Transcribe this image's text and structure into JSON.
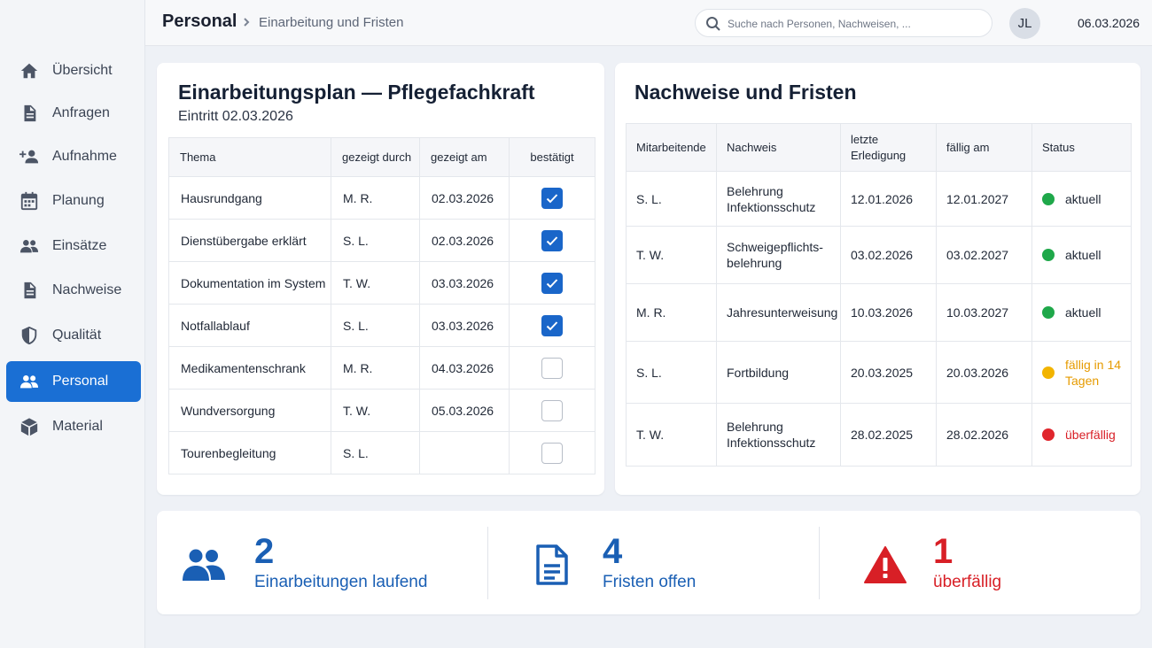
{
  "colors": {
    "accent": "#1a6fd4",
    "checkbox_on": "#1a66c9",
    "status_current": "#1fa84a",
    "status_due_soon": "#f2b400",
    "status_overdue": "#e0262d",
    "text_due_soon": "#e69b00",
    "text_overdue": "#d81f26",
    "stat_blue": "#1a5fb4",
    "stat_red": "#d81f26"
  },
  "sidebar": {
    "items": [
      {
        "label": "Übersicht",
        "icon": "home-icon",
        "active": false
      },
      {
        "label": "Anfragen",
        "icon": "document-icon",
        "active": false
      },
      {
        "label": "Aufnahme",
        "icon": "person-add-icon",
        "active": false
      },
      {
        "label": "Planung",
        "icon": "calendar-icon",
        "active": false
      },
      {
        "label": "Einsätze",
        "icon": "group-icon",
        "active": false
      },
      {
        "label": "Nachweise",
        "icon": "document-icon",
        "active": false
      },
      {
        "label": "Qualität",
        "icon": "shield-icon",
        "active": false
      },
      {
        "label": "Personal",
        "icon": "group-icon",
        "active": true
      },
      {
        "label": "Material",
        "icon": "box-icon",
        "active": false
      }
    ]
  },
  "header": {
    "section": "Personal",
    "page": "Einarbeitung und Fristen",
    "search_placeholder": "Suche nach Personen, Nachweisen, ...",
    "avatar_initials": "JL",
    "date": "06.03.2026"
  },
  "onboarding": {
    "title": "Einarbeitungsplan — Pflegefachkraft",
    "subtitle": "Eintritt 02.03.2026",
    "columns": [
      "Thema",
      "gezeigt durch",
      "gezeigt am",
      "bestätigt"
    ],
    "rows": [
      {
        "topic": "Hausrundgang",
        "by": "M. R.",
        "date": "02.03.2026",
        "confirmed": true
      },
      {
        "topic": "Dienstübergabe erklärt",
        "by": "S. L.",
        "date": "02.03.2026",
        "confirmed": true
      },
      {
        "topic": "Dokumentation im System",
        "by": "T. W.",
        "date": "03.03.2026",
        "confirmed": true
      },
      {
        "topic": "Notfallablauf",
        "by": "S. L.",
        "date": "03.03.2026",
        "confirmed": true
      },
      {
        "topic": "Medikamentenschrank",
        "by": "M. R.",
        "date": "04.03.2026",
        "confirmed": false
      },
      {
        "topic": "Wundversorgung",
        "by": "T. W.",
        "date": "05.03.2026",
        "confirmed": false
      },
      {
        "topic": "Tourenbegleitung",
        "by": "S. L.",
        "date": "",
        "confirmed": false
      }
    ]
  },
  "deadlines": {
    "title": "Nachweise und Fristen",
    "columns": [
      "Mitarbeitende",
      "Nachweis",
      "letzte Erledigung",
      "fällig am",
      "Status"
    ],
    "rows": [
      {
        "employee": "S. L.",
        "proof": "Belehrung Infektionsschutz",
        "last": "12.01.2026",
        "due": "12.01.2027",
        "status": "aktuell",
        "level": "current"
      },
      {
        "employee": "T. W.",
        "proof": "Schweigepflichts-belehrung",
        "last": "03.02.2026",
        "due": "03.02.2027",
        "status": "aktuell",
        "level": "current"
      },
      {
        "employee": "M. R.",
        "proof": "Jahresunterweisung",
        "last": "10.03.2026",
        "due": "10.03.2027",
        "status": "aktuell",
        "level": "current"
      },
      {
        "employee": "S. L.",
        "proof": "Fortbildung",
        "last": "20.03.2025",
        "due": "20.03.2026",
        "status": "fällig in 14 Tagen",
        "level": "due_soon"
      },
      {
        "employee": "T. W.",
        "proof": "Belehrung Infektionsschutz",
        "last": "28.02.2025",
        "due": "28.02.2026",
        "status": "überfällig",
        "level": "overdue"
      }
    ]
  },
  "stats": [
    {
      "value": "2",
      "label": "Einarbeitungen laufend",
      "icon": "group-icon",
      "tone": "blue"
    },
    {
      "value": "4",
      "label": "Fristen offen",
      "icon": "document-outline-icon",
      "tone": "blue"
    },
    {
      "value": "1",
      "label": "überfällig",
      "icon": "warning-icon",
      "tone": "red"
    }
  ]
}
